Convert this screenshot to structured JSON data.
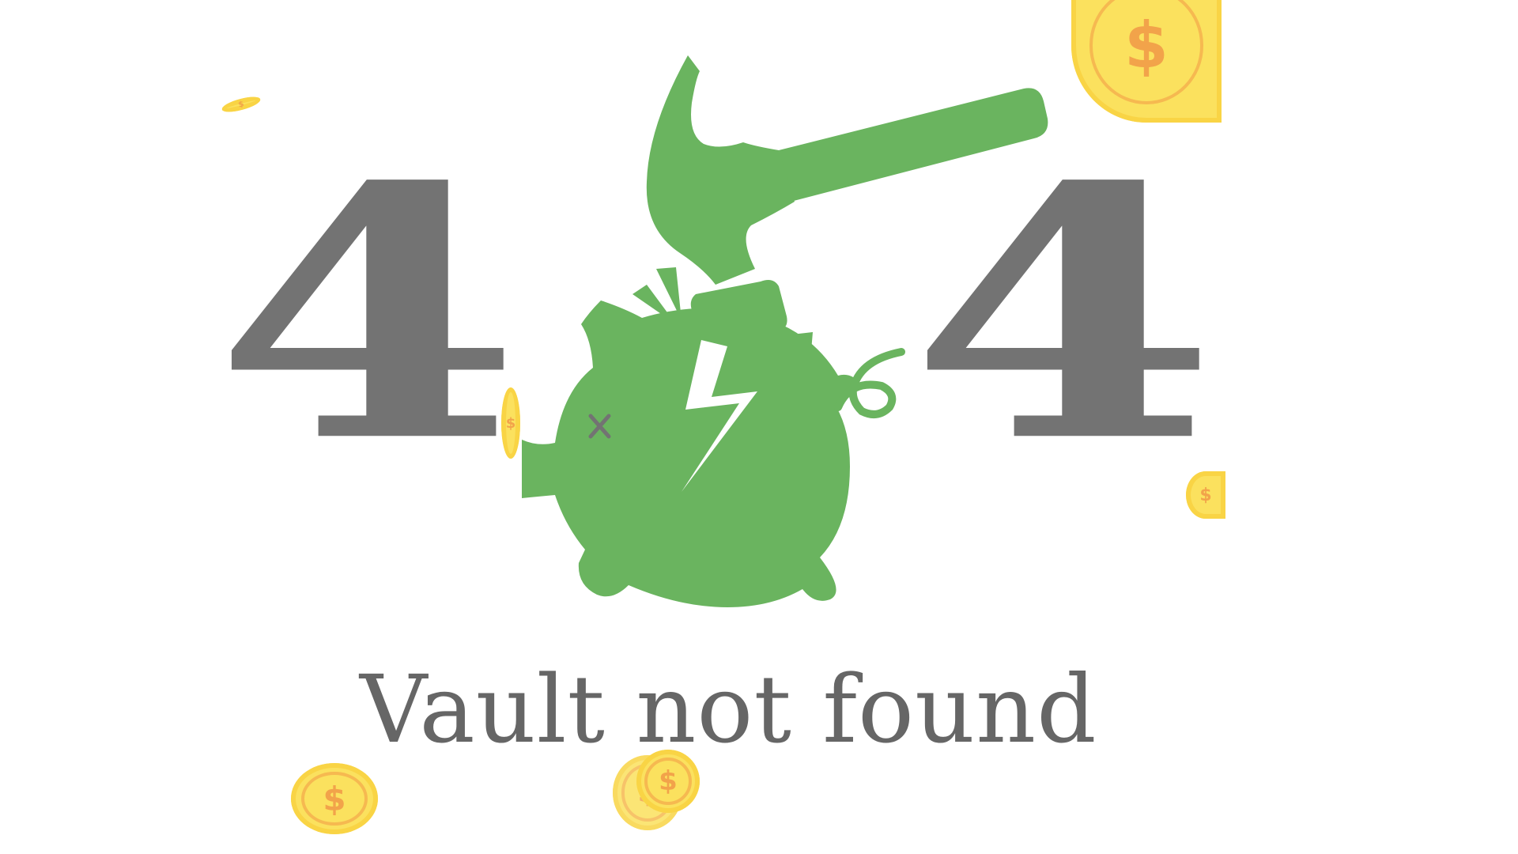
{
  "error": {
    "digit_left": "4",
    "digit_right": "4",
    "message": "Vault not found"
  },
  "colors": {
    "background": "#ffffff",
    "digits": "#737373",
    "message": "#666666",
    "pig": "#6ab45f",
    "coin": "#fbe15e",
    "coin_symbol": "#f2a34a"
  },
  "icons": {
    "illustration": "broken-piggy-bank-with-hammer",
    "coin": "dollar-coin"
  },
  "coins": {
    "symbol": "$"
  }
}
